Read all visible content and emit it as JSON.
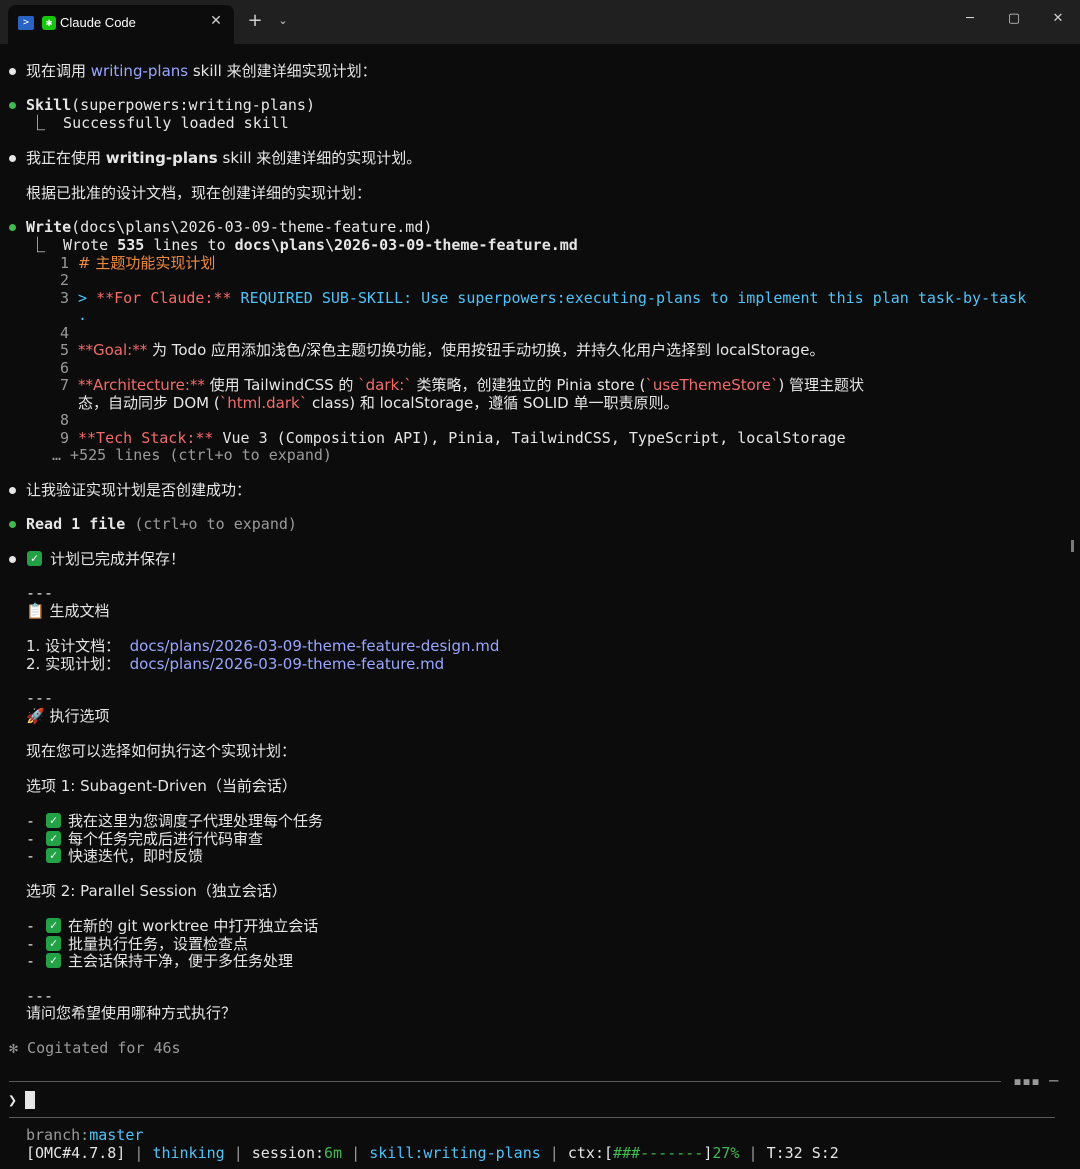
{
  "window": {
    "tab_title": "Claude Code",
    "ps_glyph": "&gt;",
    "claude_glyph": "✱",
    "close_glyph": "✕",
    "new_tab_glyph": "+",
    "dropdown_glyph": "⌄",
    "min_glyph": "─",
    "max_glyph": "▢",
    "winclose_glyph": "✕"
  },
  "lines": {
    "l1a": "现在调用 ",
    "l1b": "writing-plans",
    "l1c": " skill 来创建详细实现计划：",
    "l2a": "Skill",
    "l2b": "(superpowers:writing-plans)",
    "l3": "⎿  Successfully loaded skill",
    "l4a": "我正在使用 ",
    "l4b": "writing-plans",
    "l4c": " skill 来创建详细的实现计划。",
    "l5": "根据已批准的设计文档，现在创建详细的实现计划：",
    "l6a": "Write",
    "l6b": "(docs\\plans\\2026-03-09-theme-feature.md)",
    "l7a": "⎿  Wrote ",
    "l7b": "535",
    "l7c": " lines to ",
    "l7d": "docs\\plans\\2026-03-09-theme-feature.md",
    "c1n": "1",
    "c1": "# 主题功能实现计划",
    "c2n": "2",
    "c3n": "3",
    "c3a": "> ",
    "c3b": "**For Claude:**",
    "c3c": " REQUIRED SUB-SKILL: Use superpowers:executing-plans to implement this plan task-by-task",
    "c3d": ".",
    "c4n": "4",
    "c5n": "5",
    "c5a": "**Goal:**",
    "c5b": " 为 Todo 应用添加浅色/深色主题切换功能，使用按钮手动切换，并持久化用户选择到 localStorage。",
    "c6n": "6",
    "c7n": "7",
    "c7a": "**Architecture:**",
    "c7b": " 使用 TailwindCSS 的 ",
    "c7c": "`dark:`",
    "c7d": " 类策略，创建独立的 Pinia store (",
    "c7e": "`useThemeStore`",
    "c7f": ") 管理主题状",
    "c7g": "态，自动同步 DOM (",
    "c7h": "`html.dark`",
    "c7i": " class) 和 localStorage，遵循 SOLID 单一职责原则。",
    "c8n": "8",
    "c9n": "9",
    "c9a": "**Tech Stack:**",
    "c9b": " Vue 3 (Composition API), Pinia, TailwindCSS, TypeScript, localStorage",
    "more": "… +525 lines (ctrl+o to expand)",
    "l8": "让我验证实现计划是否创建成功：",
    "l9a": "Read ",
    "l9b": "1",
    "l9c": " file",
    "l9d": " (ctrl+o to expand)",
    "l10": "计划已完成并保存！",
    "hr1": "---",
    "h_docs": "📋 生成文档",
    "d1a": "1. 设计文档：  ",
    "d1b": "docs/plans/2026-03-09-theme-feature-design.md",
    "d2a": "2. 实现计划：  ",
    "d2b": "docs/plans/2026-03-09-theme-feature.md",
    "hr2": "---",
    "h_exec": "🚀 执行选项",
    "q1": "现在您可以选择如何执行这个实现计划：",
    "opt1": "选项 1: Subagent-Driven（当前会话）",
    "o1i1": "我在这里为您调度子代理处理每个任务",
    "o1i2": "每个任务完成后进行代码审查",
    "o1i3": "快速迭代，即时反馈",
    "opt2": "选项 2: Parallel Session（独立会话）",
    "o2i1": "在新的 git worktree 中打开独立会话",
    "o2i2": "批量执行任务，设置检查点",
    "o2i3": "主会话保持干净，便于多任务处理",
    "hr3": "---",
    "ask": "请问您希望使用哪种方式执行？",
    "cog": "✻ Cogitated for 46s",
    "dash": "-",
    "prompt": "❯",
    "sep_tail": "▪▪▪ ─"
  },
  "status": {
    "branch_label": "branch:",
    "branch": "master",
    "omc": "[OMC#4.7.8]",
    "pipe": " | ",
    "thinking": "thinking",
    "session_label": "session:",
    "session": "6m",
    "skill": "skill:writing-plans",
    "ctx_label": "ctx:[",
    "ctx_bar": "###-------",
    "ctx_close": "]",
    "ctx_pct": "27%",
    "ts": "T:32 S:2"
  }
}
